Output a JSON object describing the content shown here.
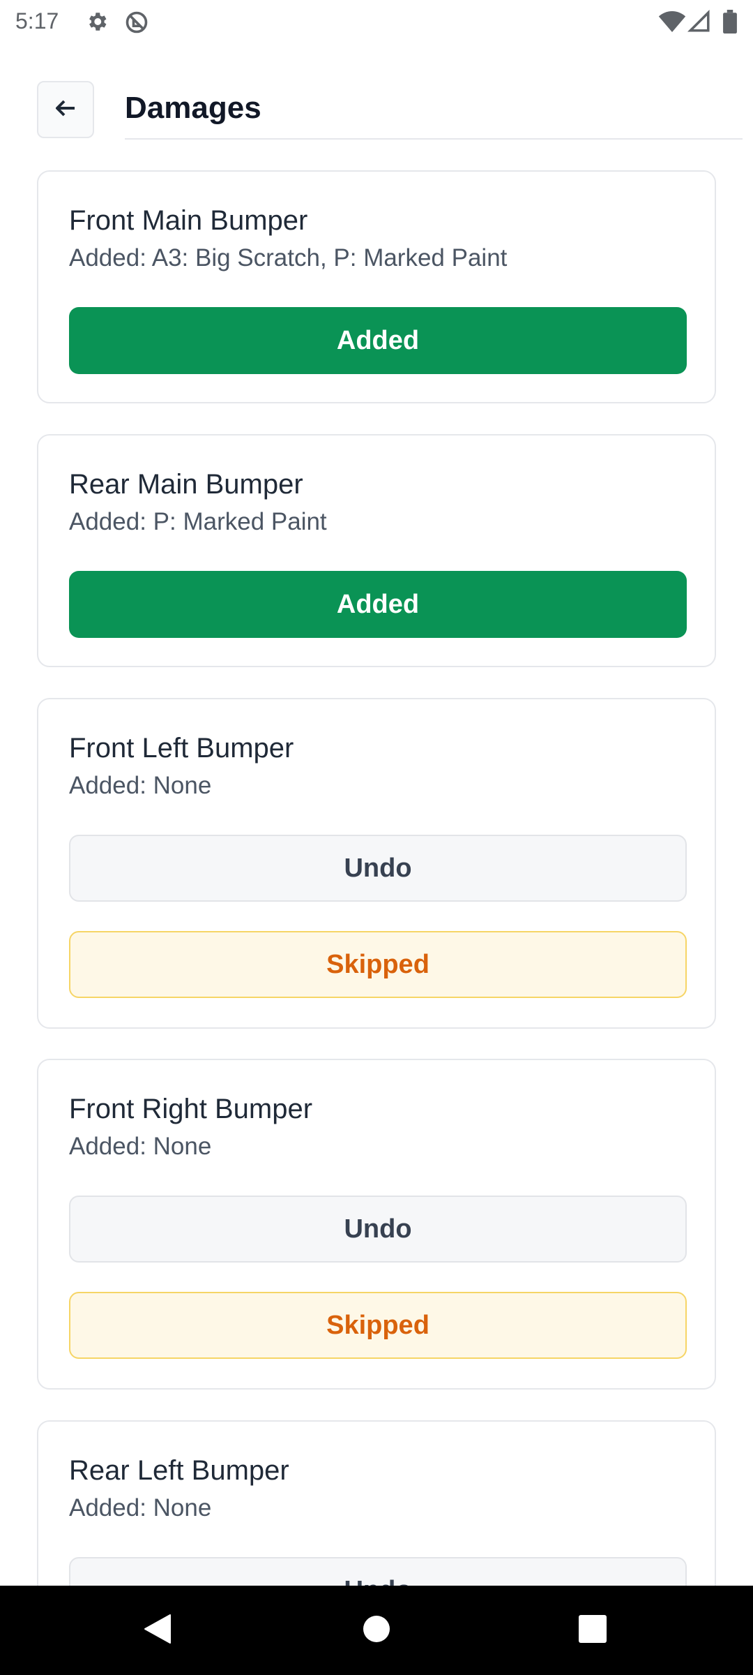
{
  "status_bar": {
    "time": "5:17",
    "left_icons": [
      "gear-icon",
      "do-not-disturb-icon"
    ],
    "right_icons": [
      "wifi-icon",
      "signal-icon",
      "battery-icon"
    ]
  },
  "header": {
    "title": "Damages",
    "back_icon": "arrow-left-icon"
  },
  "cards": [
    {
      "title": "Front Main Bumper",
      "subtitle": "Added: A3: Big Scratch, P: Marked Paint",
      "buttons": [
        {
          "label": "Added",
          "kind": "added"
        }
      ]
    },
    {
      "title": "Rear Main Bumper",
      "subtitle": "Added: P: Marked Paint",
      "buttons": [
        {
          "label": "Added",
          "kind": "added"
        }
      ]
    },
    {
      "title": "Front Left Bumper",
      "subtitle": "Added: None",
      "buttons": [
        {
          "label": "Undo",
          "kind": "undo"
        },
        {
          "label": "Skipped",
          "kind": "skipped"
        }
      ]
    },
    {
      "title": "Front Right Bumper",
      "subtitle": "Added: None",
      "buttons": [
        {
          "label": "Undo",
          "kind": "undo"
        },
        {
          "label": "Skipped",
          "kind": "skipped"
        }
      ]
    },
    {
      "title": "Rear Left Bumper",
      "subtitle": "Added: None",
      "buttons": [
        {
          "label": "Undo",
          "kind": "undo"
        }
      ]
    }
  ],
  "nav_bar": {
    "icons": [
      "back-triangle-icon",
      "home-circle-icon",
      "recents-square-icon"
    ]
  },
  "colors": {
    "added": "#0a9355",
    "skipped_text": "#d9620b",
    "skipped_bg": "#fef8e7",
    "skipped_border": "#f6d566",
    "undo_bg": "#f6f7f9"
  }
}
